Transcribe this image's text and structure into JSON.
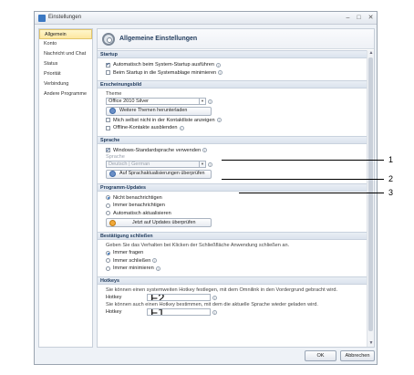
{
  "window": {
    "title": "Einstellungen",
    "buttons": [
      "–",
      "□",
      "✕"
    ]
  },
  "sidebar": {
    "items": [
      {
        "label": "Allgemein",
        "active": true
      },
      {
        "label": "Konto"
      },
      {
        "label": "Nachricht und Chat"
      },
      {
        "label": "Status"
      },
      {
        "label": "Priorität"
      },
      {
        "label": "Verbindung"
      },
      {
        "label": "Andere Programme"
      }
    ]
  },
  "main": {
    "title": "Allgemeine Einstellungen"
  },
  "startup": {
    "header": "Startup",
    "autostart": "Automatisch beim System-Startup ausführen",
    "minimize": "Beim Startup in die Systemablage minimieren"
  },
  "appearance": {
    "header": "Erscheinungsbild",
    "theme_label": "Theme",
    "theme_value": "Office 2010 Silver",
    "more_themes": "Weitere Themen herunterladen",
    "show_self": "Mich selbst nicht in der Kontaktliste anzeigen",
    "hide_offline": "Offline-Kontakte ausblenden"
  },
  "language": {
    "header": "Sprache",
    "use_windows": "Windows-Standardsprache verwenden",
    "lang_label": "Sprache",
    "lang_value": "Deutsch | German",
    "check_updates": "Auf Sprachaktualisierungen überprüfen"
  },
  "updates": {
    "header": "Programm-Updates",
    "opt1": "Nicht benachrichtigen",
    "opt2": "Immer benachrichtigen",
    "opt3": "Automatisch aktualisieren",
    "check_now": "Jetzt auf Updates überprüfen"
  },
  "closing": {
    "header": "Bestätigung schließen",
    "desc": "Geben Sie das Verhalten bei Klicken der Schließfläche Anwendung schließen an.",
    "opt1": "Immer fragen",
    "opt2": "Immer schließen",
    "opt3": "Immer minimieren"
  },
  "hotkeys": {
    "header": "Hotkeys",
    "desc1": "Sie können einen systemweiten Hotkey festlegen, mit dem Omnilink in den Vordergrund gebracht wird.",
    "label1": "Hotkey",
    "value1": "F2",
    "desc2": "Sie können auch einen Hotkey bestimmen, mit dem die aktuelle Sprache wieder geladen wird.",
    "label2": "Hotkey",
    "value2": "F1"
  },
  "footer": {
    "ok": "OK",
    "cancel": "Abbrechen"
  },
  "callouts": [
    "1",
    "2",
    "3"
  ]
}
